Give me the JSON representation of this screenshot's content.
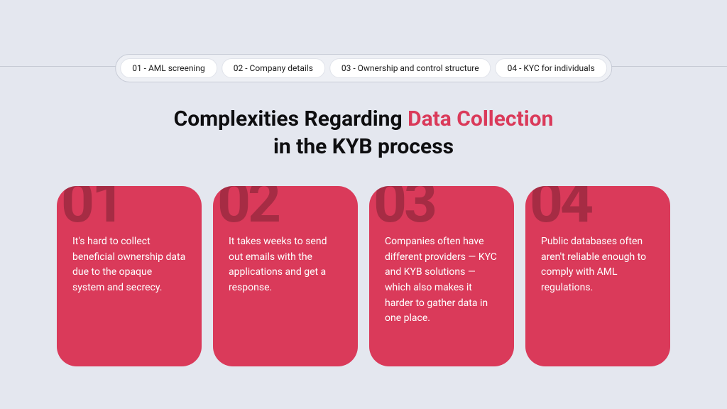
{
  "tabs": [
    {
      "label": "01 - AML screening"
    },
    {
      "label": "02 - Company details"
    },
    {
      "label": "03 - Ownership and control structure"
    },
    {
      "label": "04 - KYC for individuals"
    }
  ],
  "headline": {
    "part1": "Complexities Regarding ",
    "accent": "Data Collection",
    "part2": "in the KYB process"
  },
  "cards": [
    {
      "num": "01",
      "text": "It's hard to collect beneficial ownership data due to the opaque system and secrecy."
    },
    {
      "num": "02",
      "text": "It takes weeks to send out emails with the applications and get a response."
    },
    {
      "num": "03",
      "text": "Companies often have different providers — KYC and KYB solutions — which also makes it harder to gather data in one place."
    },
    {
      "num": "04",
      "text": "Public databases often aren't reliable enough to comply with AML regulations."
    }
  ]
}
